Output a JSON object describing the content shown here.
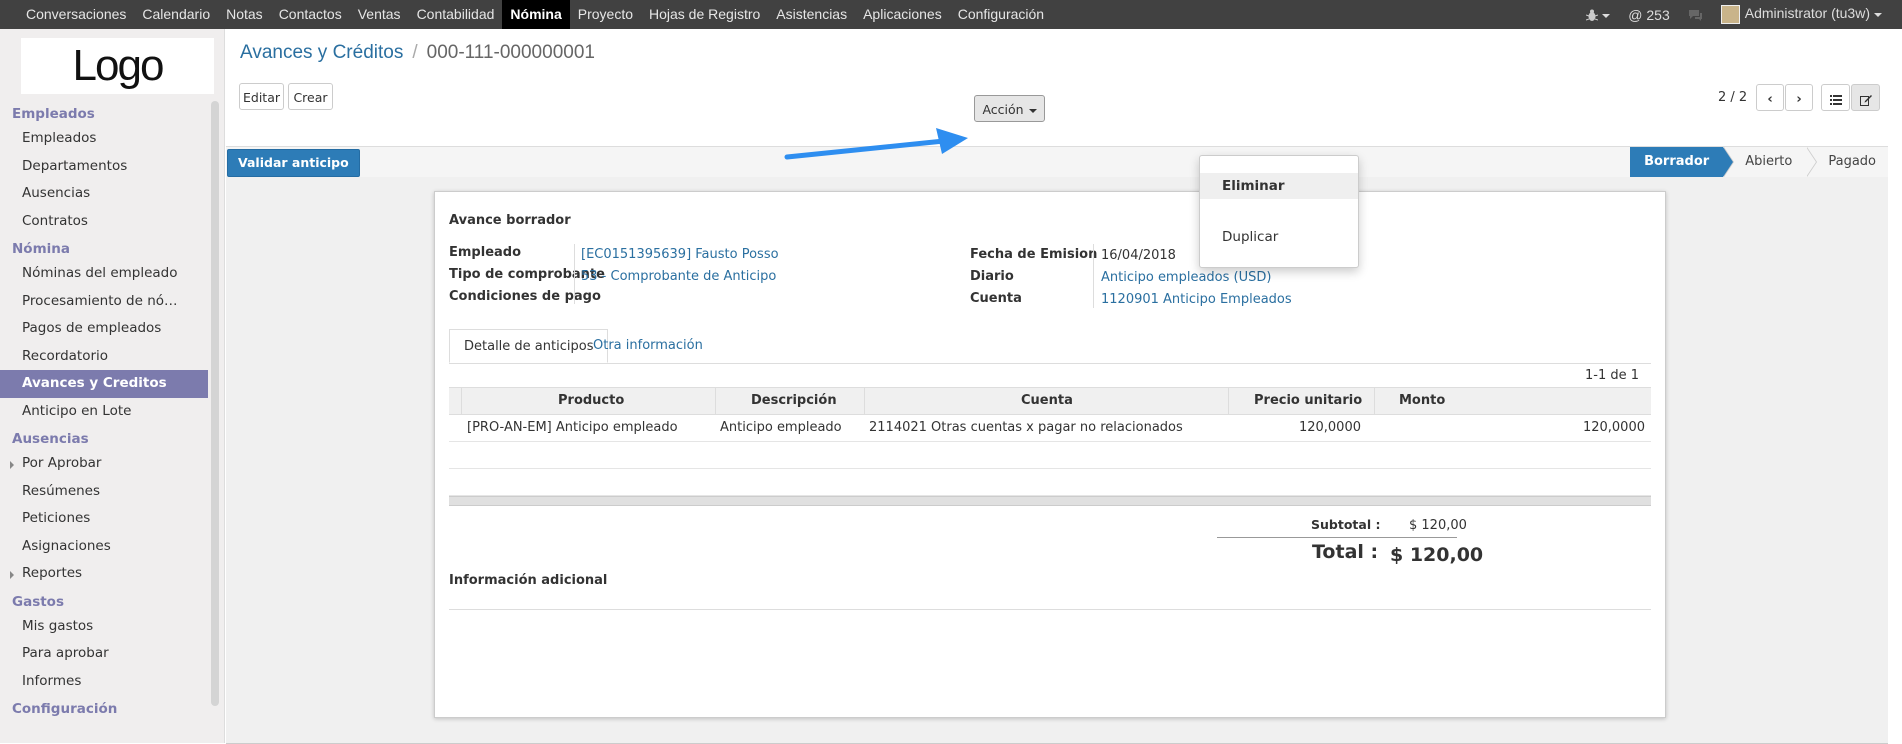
{
  "topbar": {
    "menu": [
      "Conversaciones",
      "Calendario",
      "Notas",
      "Contactos",
      "Ventas",
      "Contabilidad",
      "Nómina",
      "Proyecto",
      "Hojas de Registro",
      "Asistencias",
      "Aplicaciones",
      "Configuración"
    ],
    "active_menu": "Nómina",
    "notifications": "@ 253",
    "user": "Administrator (tu3w)"
  },
  "sidebar": {
    "logo_text": "Logo",
    "sections": [
      {
        "title": "Empleados",
        "items": [
          "Empleados",
          "Departamentos",
          "Ausencias",
          "Contratos"
        ]
      },
      {
        "title": "Nómina",
        "items": [
          "Nóminas del empleado",
          "Procesamiento de nó…",
          "Pagos de empleados",
          "Recordatorio",
          "Avances y Creditos",
          "Anticipo en Lote"
        ]
      },
      {
        "title": "Ausencias",
        "items": [
          "Por Aprobar",
          "Resúmenes",
          "Peticiones",
          "Asignaciones",
          "Reportes"
        ]
      },
      {
        "title": "Gastos",
        "items": [
          "Mis gastos",
          "Para aprobar",
          "Informes"
        ]
      },
      {
        "title": "Configuración",
        "items": []
      }
    ],
    "active_item": "Avances y Creditos"
  },
  "breadcrumb": {
    "parent": "Avances y Créditos",
    "separator": "/",
    "current": "000-111-000000001"
  },
  "toolbar": {
    "edit_label": "Editar",
    "create_label": "Crear",
    "action_label": "Acción"
  },
  "pager": {
    "text": "2 / 2"
  },
  "dropdown": {
    "delete_label": "Eliminar",
    "duplicate_label": "Duplicar"
  },
  "statusbar": {
    "validate_label": "Validar anticipo",
    "stages": [
      {
        "label": "Borrador",
        "active": true
      },
      {
        "label": "Abierto",
        "active": false
      },
      {
        "label": "Pagado",
        "active": false
      }
    ]
  },
  "form": {
    "title": "Avance borrador",
    "left": [
      {
        "label": "Empleado",
        "value": "[EC0151395639] Fausto Posso"
      },
      {
        "label": "Tipo de comprobante",
        "value": "53 - Comprobante de Anticipo"
      },
      {
        "label": "Condiciones de pago",
        "value": ""
      }
    ],
    "right": [
      {
        "label": "Fecha de Emision",
        "value": "16/04/2018"
      },
      {
        "label": "Diario",
        "value": "Anticipo empleados (USD)"
      },
      {
        "label": "Cuenta",
        "value": "1120901 Anticipo Empleados"
      }
    ],
    "tabs": [
      "Detalle de anticipos",
      "Otra información"
    ],
    "record_count": "1-1 de 1",
    "table": {
      "headers": [
        "Producto",
        "Descripción",
        "Cuenta",
        "Precio unitario",
        "Monto"
      ],
      "rows": [
        [
          "[PRO-AN-EM] Anticipo empleado",
          "Anticipo empleado",
          "2114021 Otras cuentas x pagar no relacionados",
          "120,0000",
          "120,0000"
        ]
      ]
    },
    "subtotal_label": "Subtotal :",
    "subtotal_value": "$ 120,00",
    "total_label": "Total :",
    "total_value": "$ 120,00",
    "additional_info_label": "Información adicional"
  },
  "colors": {
    "topbar": "#414141",
    "sidebar_accent": "#7c7bad",
    "primary": "#2d7cb7",
    "link": "#2a6fa0",
    "arrow": "#2e8ef0"
  }
}
